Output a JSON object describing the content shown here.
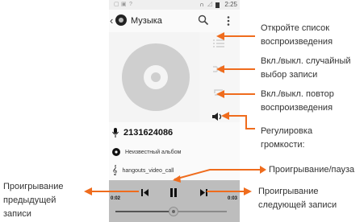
{
  "status_bar": {
    "clock": "2:25"
  },
  "app_bar": {
    "title": "Музыка"
  },
  "track": {
    "artist": "2131624086",
    "album": "Неизвестный альбом",
    "file": "hangouts_video_call"
  },
  "player": {
    "elapsed": "0:02",
    "duration": "0:03",
    "progress_fraction": 0.52
  },
  "callouts": {
    "playlist": [
      "Откройте список",
      "воспроизведения"
    ],
    "shuffle": [
      "Вкл./выкл. случайный",
      "выбор записи"
    ],
    "repeat": [
      "Вкл./выкл. повтор",
      "воспроизведения"
    ],
    "volume": [
      "Регулировка",
      "громкости:"
    ],
    "play_pause": [
      "Проигрывание/пауза"
    ],
    "previous": [
      "Проигрывание",
      "предыдущей",
      "записи"
    ],
    "next": [
      "Проигрывание",
      "следующей записи"
    ]
  },
  "colors": {
    "arrow": "#ef6c1d",
    "control_bar": "#bdbdbd"
  }
}
